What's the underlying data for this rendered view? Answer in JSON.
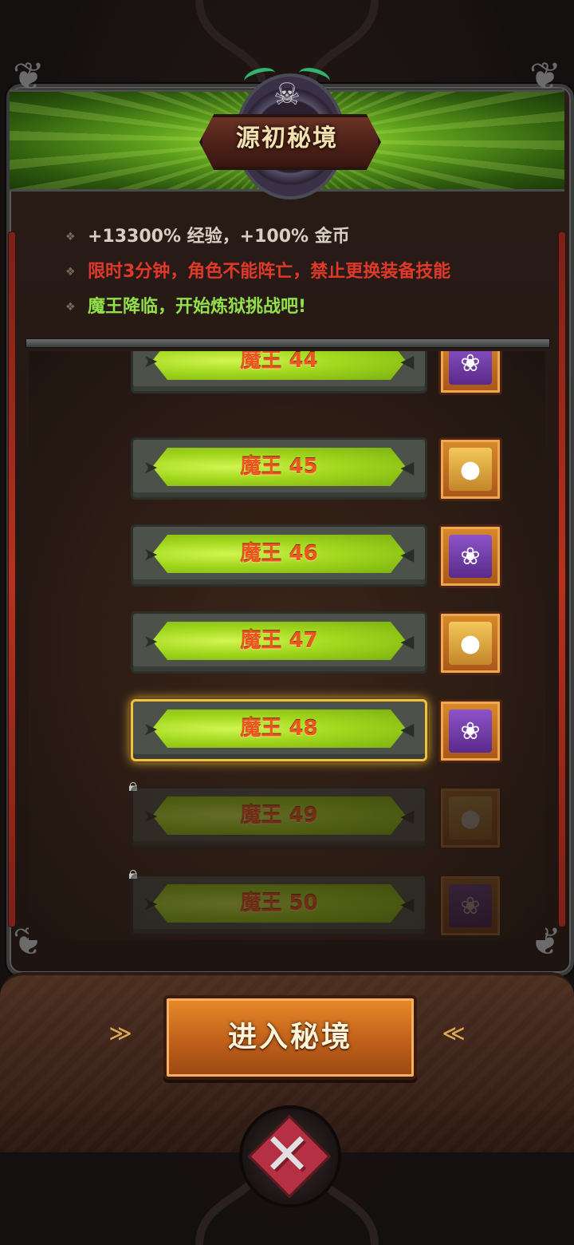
{
  "header": {
    "title": "源初秘境"
  },
  "info": {
    "line1": "+13300% 经验，+100% 金币",
    "line2": "限时3分钟，角色不能阵亡，禁止更换装备技能",
    "line3": "魔王降临，开始炼狱挑战吧!"
  },
  "levels": [
    {
      "label": "魔王 44",
      "reward": "purple-chest-icon",
      "state": "unlocked"
    },
    {
      "label": "魔王 45",
      "reward": "gold-chest-icon",
      "state": "unlocked"
    },
    {
      "label": "魔王 46",
      "reward": "purple-chest-icon",
      "state": "unlocked"
    },
    {
      "label": "魔王 47",
      "reward": "gold-chest-icon",
      "state": "unlocked"
    },
    {
      "label": "魔王 48",
      "reward": "purple-chest-icon",
      "state": "selected"
    },
    {
      "label": "魔王 49",
      "reward": "gold-chest-icon",
      "state": "locked"
    },
    {
      "label": "魔王 50",
      "reward": "purple-chest-icon",
      "state": "locked"
    }
  ],
  "footer": {
    "enter_label": "进入秘境"
  },
  "colors": {
    "accent_green": "#a2d81e",
    "warning_red": "#e0392a",
    "highlight_green": "#92e04a",
    "level_text": "#e8581c",
    "selected_border": "#f0c040",
    "button_orange": "#c0601a"
  }
}
